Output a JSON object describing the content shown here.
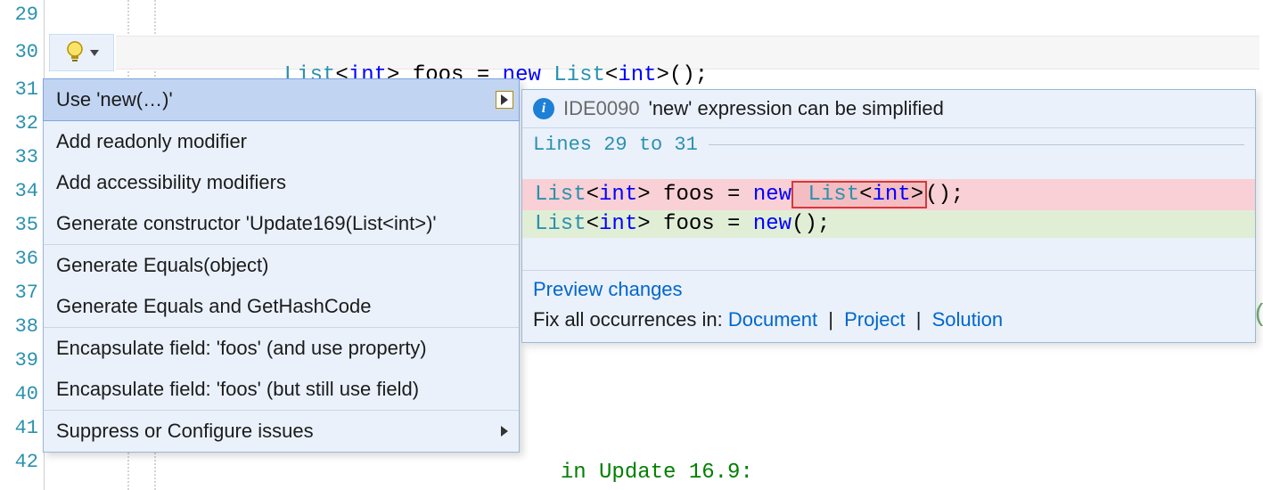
{
  "editor": {
    "line_numbers": [
      "29",
      "30",
      "31",
      "32",
      "33",
      "34",
      "35",
      "36",
      "37",
      "38",
      "39",
      "40",
      "41",
      "42"
    ],
    "code_line_30": {
      "t1": "List",
      "t2": "<",
      "t3": "int",
      "t4": "> foos = ",
      "t5": "new ",
      "t6": "List",
      "t7": "<",
      "t8": "int",
      "t9": ">();"
    },
    "comment_visible": "in Update 16.9:"
  },
  "quick_actions": {
    "items": [
      {
        "label": "Use 'new(…)'",
        "has_submenu": true
      },
      {
        "label": "Add readonly modifier"
      },
      {
        "label": "Add accessibility modifiers"
      },
      {
        "label": "Generate constructor 'Update169(List<int>)'"
      },
      {
        "label": "Generate Equals(object)"
      },
      {
        "label": "Generate Equals and GetHashCode"
      },
      {
        "label": "Encapsulate field: 'foos' (and use property)"
      },
      {
        "label": "Encapsulate field: 'foos' (but still use field)"
      },
      {
        "label": "Suppress or Configure issues",
        "has_submenu": true
      }
    ]
  },
  "preview": {
    "code": "IDE0090",
    "message": "'new' expression can be simplified",
    "range_label": "Lines 29 to 31",
    "diff_old": {
      "a": "List",
      "b": "<",
      "c": "int",
      "d": "> foos = ",
      "e": "new",
      "hl": " List<int>",
      "f": "();"
    },
    "diff_new": {
      "a": "List",
      "b": "<",
      "c": "int",
      "d": "> foos = ",
      "e": "new",
      "f": "();"
    },
    "footer": {
      "preview_changes": "Preview changes",
      "fix_label": "Fix all occurrences in:",
      "links": {
        "document": "Document",
        "project": "Project",
        "solution": "Solution"
      },
      "sep": "|"
    }
  }
}
